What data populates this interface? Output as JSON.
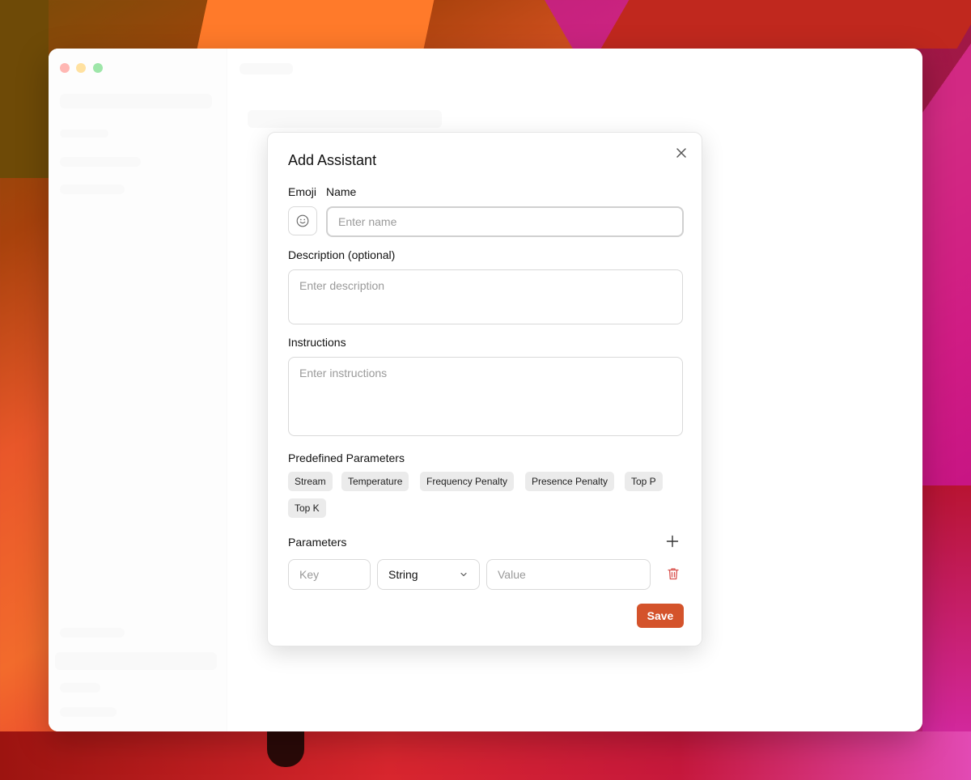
{
  "dialog": {
    "title": "Add Assistant",
    "emoji_label": "Emoji",
    "name_label": "Name",
    "name_placeholder": "Enter name",
    "description_label": "Description (optional)",
    "description_placeholder": "Enter description",
    "instructions_label": "Instructions",
    "instructions_placeholder": "Enter instructions",
    "predefined_label": "Predefined Parameters",
    "predefined_parameters": [
      "Stream",
      "Temperature",
      "Frequency Penalty",
      "Presence Penalty",
      "Top P",
      "Top K"
    ],
    "parameters_label": "Parameters",
    "parameter_row": {
      "key_placeholder": "Key",
      "type_selected": "String",
      "value_placeholder": "Value"
    },
    "save_label": "Save",
    "icons": {
      "close": "close-icon",
      "emoji": "smiley-icon",
      "add": "plus-icon",
      "delete": "trash-icon",
      "dropdown": "chevron-down-icon"
    }
  },
  "colors": {
    "accent": "#d4532b",
    "delete_icon": "#d9534f",
    "chip_bg": "#ebebeb"
  }
}
